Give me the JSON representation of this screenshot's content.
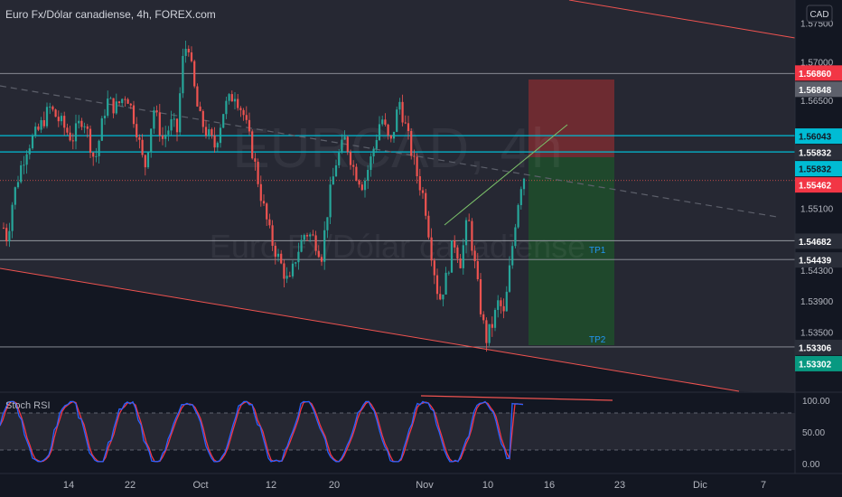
{
  "header": {
    "symbol_title": "Euro Fx/Dólar canadiense, 4h, FOREX.com",
    "currency_button": "CAD"
  },
  "watermark": {
    "ticker": "EURCAD, 4h",
    "name": "Euro Fx/Dólar canadiense"
  },
  "annotations": {
    "tp1": "TP1",
    "tp2": "TP2"
  },
  "rsi_panel": {
    "title": "Stoch RSI"
  },
  "colors": {
    "background": "#131722",
    "channel_fill": "#262833",
    "bull": "#26a69a",
    "bear": "#ef5350",
    "cyan_line": "#00bcd4",
    "stop_zone": "#7a2b31",
    "target_zone": "#1f4e2b",
    "rsi_k": "#2962ff",
    "rsi_d": "#f23645"
  },
  "chart_data": {
    "type": "candlestick",
    "symbol": "EURCAD",
    "timeframe": "4h",
    "ylim": [
      1.5272,
      1.578
    ],
    "x_ticks": [
      "14",
      "22",
      "Oct",
      "12",
      "20",
      "Nov",
      "10",
      "16",
      "23",
      "Dic",
      "7"
    ],
    "y_ticks": [
      "1.57500",
      "1.57000",
      "1.56500",
      "1.55100",
      "1.54300",
      "1.53900",
      "1.53500"
    ],
    "price_labels": [
      {
        "value": "1.56860",
        "style": "red"
      },
      {
        "value": "1.56848",
        "style": "gray"
      },
      {
        "value": "1.56043",
        "style": "cyan"
      },
      {
        "value": "1.55832",
        "style": "dark"
      },
      {
        "value": "1.55832",
        "style": "cyan"
      },
      {
        "value": "1.55462",
        "style": "red"
      },
      {
        "value": "1.54682",
        "style": "dark"
      },
      {
        "value": "1.54439",
        "style": "dark"
      },
      {
        "value": "1.53306",
        "style": "dark"
      },
      {
        "value": "1.53302",
        "style": "green"
      }
    ],
    "horizontal_levels": [
      {
        "price": 1.56848,
        "color": "gray"
      },
      {
        "price": 1.56043,
        "color": "cyan"
      },
      {
        "price": 1.55832,
        "color": "cyan"
      },
      {
        "price": 1.54682,
        "color": "gray"
      },
      {
        "price": 1.54439,
        "color": "gray"
      },
      {
        "price": 1.53306,
        "color": "gray"
      }
    ],
    "current_price": 1.55462,
    "position": {
      "entry": 1.55832,
      "stop": 1.5686,
      "target": 1.53302,
      "tp1": 1.54439,
      "tp2": 1.53306
    },
    "price_path": [
      [
        0,
        1.55
      ],
      [
        8,
        1.547
      ],
      [
        14,
        1.552
      ],
      [
        22,
        1.556
      ],
      [
        30,
        1.559
      ],
      [
        42,
        1.561
      ],
      [
        55,
        1.564
      ],
      [
        68,
        1.562
      ],
      [
        80,
        1.56
      ],
      [
        92,
        1.563
      ],
      [
        105,
        1.557
      ],
      [
        118,
        1.565
      ],
      [
        128,
        1.564
      ],
      [
        140,
        1.566
      ],
      [
        150,
        1.562
      ],
      [
        160,
        1.556
      ],
      [
        170,
        1.564
      ],
      [
        180,
        1.56
      ],
      [
        190,
        1.562
      ],
      [
        196,
        1.561
      ],
      [
        202,
        1.57
      ],
      [
        208,
        1.573
      ],
      [
        213,
        1.568
      ],
      [
        220,
        1.563
      ],
      [
        228,
        1.561
      ],
      [
        238,
        1.559
      ],
      [
        248,
        1.564
      ],
      [
        260,
        1.566
      ],
      [
        270,
        1.563
      ],
      [
        280,
        1.558
      ],
      [
        290,
        1.552
      ],
      [
        300,
        1.547
      ],
      [
        310,
        1.544
      ],
      [
        320,
        1.541
      ],
      [
        328,
        1.545
      ],
      [
        338,
        1.548
      ],
      [
        348,
        1.547
      ],
      [
        356,
        1.545
      ],
      [
        364,
        1.552
      ],
      [
        372,
        1.557
      ],
      [
        382,
        1.56
      ],
      [
        392,
        1.556
      ],
      [
        402,
        1.554
      ],
      [
        412,
        1.558
      ],
      [
        422,
        1.563
      ],
      [
        432,
        1.559
      ],
      [
        442,
        1.565
      ],
      [
        452,
        1.56
      ],
      [
        460,
        1.556
      ],
      [
        470,
        1.552
      ],
      [
        478,
        1.545
      ],
      [
        486,
        1.539
      ],
      [
        494,
        1.542
      ],
      [
        502,
        1.547
      ],
      [
        510,
        1.544
      ],
      [
        518,
        1.55
      ],
      [
        524,
        1.545
      ],
      [
        532,
        1.538
      ],
      [
        538,
        1.534
      ],
      [
        545,
        1.536
      ],
      [
        552,
        1.539
      ],
      [
        558,
        1.537
      ],
      [
        564,
        1.543
      ],
      [
        570,
        1.549
      ],
      [
        576,
        1.554
      ],
      [
        582,
        1.5558
      ]
    ],
    "stoch_rsi": {
      "ylim": [
        0,
        100
      ],
      "y_ticks": [
        "100.00",
        "50.00",
        "0.00"
      ],
      "bands": [
        80,
        20
      ]
    }
  }
}
